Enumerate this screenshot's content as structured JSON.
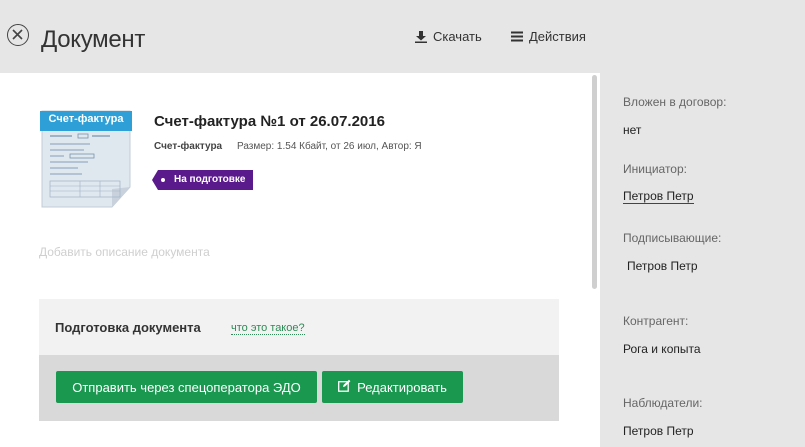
{
  "header": {
    "title": "Документ",
    "download_label": "Скачать",
    "actions_label": "Действия"
  },
  "document": {
    "thumb_label": "Счет-фактура",
    "title": "Счет-фактура №1 от 26.07.2016",
    "type": "Счет-фактура",
    "meta": "Размер: 1.54 Кбайт, от 26 июл, Автор: Я",
    "status": "На подготовке",
    "description_placeholder": "Добавить описание документа"
  },
  "preparation": {
    "title": "Подготовка документа",
    "help_link": "что это такое?",
    "send_button": "Отправить через спецоператора ЭДО",
    "edit_button": "Редактировать"
  },
  "sidebar": {
    "contract_label": "Вложен в договор:",
    "contract_value": "нет",
    "initiator_label": "Инициатор:",
    "initiator_value": "Петров Петр",
    "signers_label": "Подписывающие:",
    "signers_value": "Петров Петр",
    "counterparty_label": "Контрагент:",
    "counterparty_value": "Рога и копыта",
    "observers_label": "Наблюдатели:",
    "observers_value": "Петров Петр"
  },
  "colors": {
    "accent_green": "#1a9850",
    "status_purple": "#5b1a8c",
    "thumb_blue": "#2f9fd8"
  }
}
